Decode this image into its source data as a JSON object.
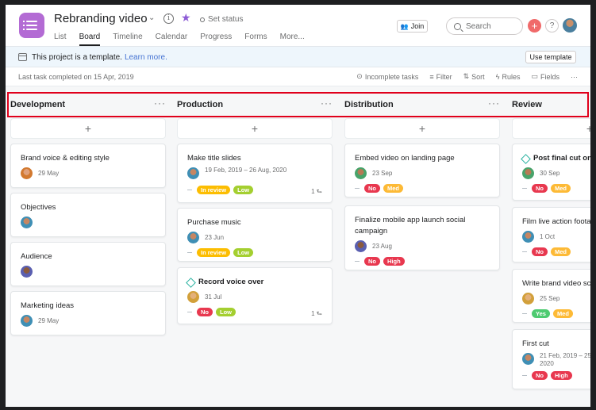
{
  "header": {
    "title": "Rebranding video",
    "set_status": "Set status",
    "tabs": [
      "List",
      "Board",
      "Timeline",
      "Calendar",
      "Progress",
      "Forms",
      "More..."
    ],
    "active_tab": "Board",
    "join_label": "Join",
    "search_placeholder": "Search",
    "help_label": "?",
    "add_label": "+"
  },
  "banner": {
    "text": "This project is a template.",
    "link": "Learn more.",
    "button": "Use template"
  },
  "toolbar": {
    "last_task": "Last task completed on 15 Apr, 2019",
    "tools": [
      "Incomplete tasks",
      "Filter",
      "Sort",
      "Rules",
      "Fields"
    ],
    "more": "···"
  },
  "colors": {
    "accent": "#b36bd4",
    "highlight": "#e0001b",
    "no": "#e8384f",
    "low": "#a4cf30",
    "med": "#fdba36",
    "high": "#e8384f",
    "in_review": "#fcbd01",
    "yes": "#4ecb71"
  },
  "columns": [
    {
      "name": "Development",
      "add": "+",
      "cards": [
        {
          "title": "Brand voice & editing style",
          "date": "29 May",
          "avatar": "a1"
        },
        {
          "title": "Objectives",
          "date": "",
          "avatar": "a2"
        },
        {
          "title": "Audience",
          "date": "",
          "avatar": "a3"
        },
        {
          "title": "Marketing ideas",
          "date": "29 May",
          "avatar": "a2"
        }
      ]
    },
    {
      "name": "Production",
      "add": "+",
      "cards": [
        {
          "title": "Make title slides",
          "date": "19 Feb, 2019 – 26 Aug, 2020",
          "avatar": "a2",
          "tags": [
            "In review",
            "Low"
          ],
          "subtasks": "1"
        },
        {
          "title": "Purchase music",
          "date": "23 Jun",
          "avatar": "a2",
          "tags": [
            "In review",
            "Low"
          ]
        },
        {
          "title": "Record voice over",
          "milestone": true,
          "date": "31 Jul",
          "avatar": "a4",
          "tags": [
            "No",
            "Low"
          ],
          "subtasks": "1"
        }
      ]
    },
    {
      "name": "Distribution",
      "add": "+",
      "cards": [
        {
          "title": "Embed video on landing page",
          "date": "23 Sep",
          "avatar": "a5",
          "tags": [
            "No",
            "Med"
          ]
        },
        {
          "title": "Finalize mobile app launch social campaign",
          "date": "23 Aug",
          "avatar": "a3",
          "tags": [
            "No",
            "High"
          ]
        }
      ]
    },
    {
      "name": "Review",
      "add": "+",
      "cards": [
        {
          "title": "Post final cut on",
          "milestone": true,
          "date": "30 Sep",
          "avatar": "a5",
          "tags": [
            "No",
            "Med"
          ]
        },
        {
          "title": "Film live action foota",
          "date": "1 Oct",
          "avatar": "a2",
          "tags": [
            "No",
            "Med"
          ]
        },
        {
          "title": "Write brand video sc",
          "date": "25 Sep",
          "avatar": "a4",
          "tags": [
            "Yes",
            "Med"
          ]
        },
        {
          "title": "First cut",
          "date": "21 Feb, 2019 – 25 2020",
          "avatar": "a2",
          "tags": [
            "No",
            "High"
          ]
        }
      ]
    }
  ]
}
